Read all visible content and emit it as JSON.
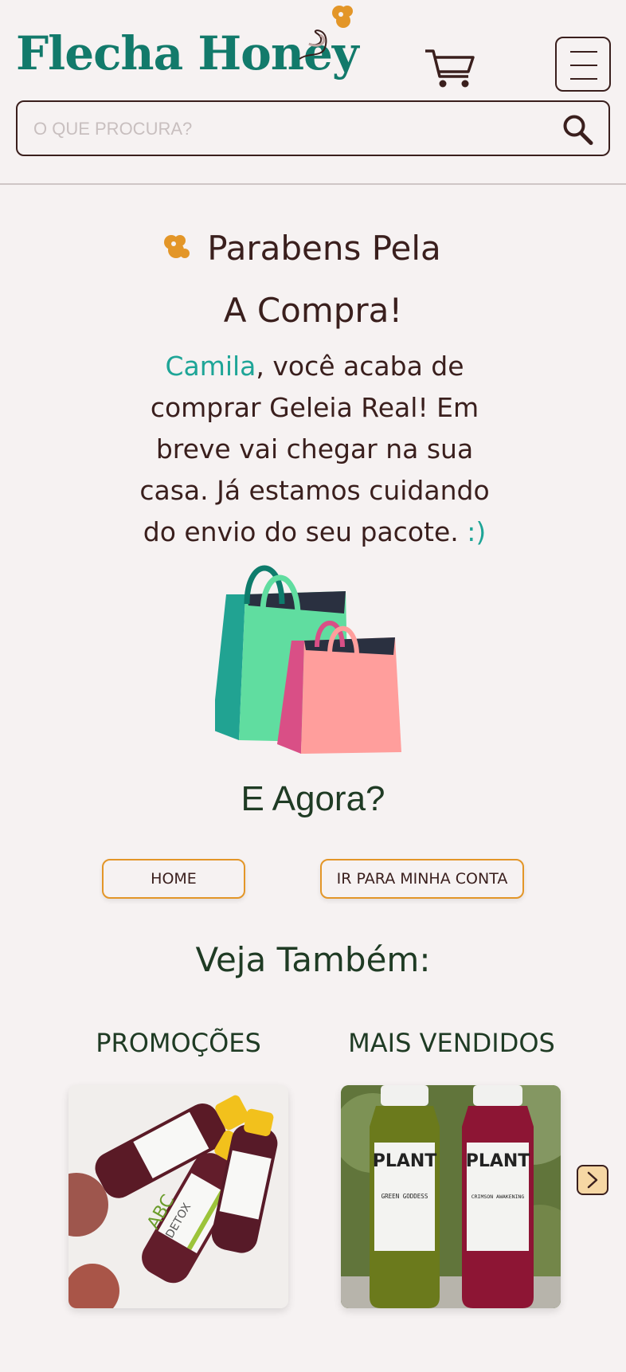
{
  "header": {
    "brand": "Flecha Honey",
    "search_placeholder": "O QUE PROCURA?"
  },
  "congrats": {
    "title_line1": "Parabens Pela",
    "title_line2": "A Compra!",
    "customer_name": "Camila",
    "message_part1": ", você acaba de comprar Geleia Real! Em breve vai chegar na sua casa. Já estamos cuidando do envio do seu pacote. ",
    "smiley": ":)"
  },
  "next_steps": {
    "heading": "E Agora?",
    "home_button": "HOME",
    "account_button": "IR PARA MINHA CONTA"
  },
  "see_also": {
    "heading": "Veja Também:",
    "categories": [
      {
        "label": "PROMOÇÕES",
        "product_text": "ABC DETOX"
      },
      {
        "label": "MAIS VENDIDOS",
        "product_text": "PLANT"
      }
    ]
  },
  "product_labels": {
    "abc_line1": "ABC",
    "abc_line2": "DETOX",
    "plant_brand": "PLANT",
    "plant1_name": "GREEN GODDESS",
    "plant2_name": "CRIMSON AWAKENING"
  },
  "colors": {
    "brand_green": "#127a6b",
    "accent_teal": "#1ea597",
    "button_border": "#e39628",
    "text_dark": "#3a1f1d",
    "background": "#f6f2f2"
  },
  "icons": [
    "bee-logo-icon",
    "cart-icon",
    "menu-icon",
    "search-icon",
    "shopping-bags-icon",
    "chevron-right-icon"
  ]
}
